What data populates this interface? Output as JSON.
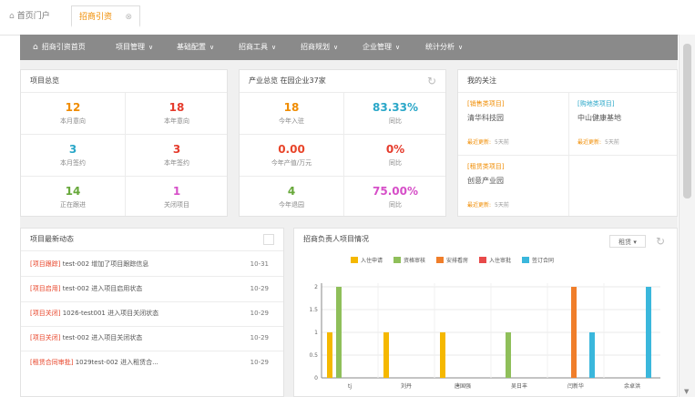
{
  "tabs": [
    {
      "label": "首页门户",
      "icon": "home-icon"
    },
    {
      "label": "招商引资",
      "icon": "close-icon"
    }
  ],
  "nav": {
    "home": "招商引资首页",
    "items": [
      "项目管理",
      "基础配置",
      "招商工具",
      "招商规划",
      "企业管理",
      "统计分析"
    ]
  },
  "project_overview": {
    "title": "项目总览",
    "stats": [
      {
        "value": "12",
        "label": "本月意向",
        "color": "#f08c00"
      },
      {
        "value": "18",
        "label": "本年意向",
        "color": "#e53b2c"
      },
      {
        "value": "3",
        "label": "本月签约",
        "color": "#2aa7c8"
      },
      {
        "value": "3",
        "label": "本年签约",
        "color": "#e53b2c"
      },
      {
        "value": "14",
        "label": "正在跟进",
        "color": "#67a83a"
      },
      {
        "value": "1",
        "label": "关闭项目",
        "color": "#d64fc8"
      }
    ]
  },
  "industry_overview": {
    "title": "产业总览 在园企业37家",
    "stats": [
      {
        "value": "18",
        "label": "今年入驻",
        "color": "#f08c00"
      },
      {
        "value": "83.33%",
        "label": "同比",
        "color": "#2aa7c8"
      },
      {
        "value": "0.00",
        "label": "今年产值/万元",
        "color": "#e8452a"
      },
      {
        "value": "0%",
        "label": "同比",
        "color": "#e53b2c"
      },
      {
        "value": "4",
        "label": "今年退园",
        "color": "#67a83a"
      },
      {
        "value": "75.00%",
        "label": "同比",
        "color": "#d64fc8"
      }
    ]
  },
  "favorites": {
    "title": "我的关注",
    "update_label": "最近更新:",
    "items": [
      {
        "category": "[销售类项目]",
        "name": "清华科技园",
        "updated": "5天前"
      },
      {
        "category": "[购地类项目]",
        "name": "中山健康基地",
        "updated": "5天前"
      },
      {
        "category": "[租赁类项目]",
        "name": "创意产业园",
        "updated": "5天前"
      }
    ]
  },
  "news": {
    "title": "项目最新动态",
    "items": [
      {
        "tag": "[项目跟踪]",
        "text": "test-002 增加了项目跟踪信息",
        "date": "10-31"
      },
      {
        "tag": "[项目启用]",
        "text": "test-002 进入项目启用状态",
        "date": "10-29"
      },
      {
        "tag": "[项目关闭]",
        "text": "1026-test001 进入项目关闭状态",
        "date": "10-29"
      },
      {
        "tag": "[项目关闭]",
        "text": "test-002 进入项目关闭状态",
        "date": "10-29"
      },
      {
        "tag": "[租赁合同审批]",
        "text": "1029test-002 进入租赁合...",
        "date": "10-29"
      }
    ]
  },
  "manager_chart": {
    "title": "招商负责人项目情况",
    "filter": "租赁"
  },
  "chart_data": {
    "type": "bar",
    "categories": [
      "tj",
      "刘丹",
      "唐国强",
      "吴日丰",
      "闫新华",
      "余卓洪"
    ],
    "series": [
      {
        "name": "入住申请",
        "color": "#f5b800",
        "values": [
          1,
          1,
          1,
          0,
          0,
          0
        ]
      },
      {
        "name": "资格审核",
        "color": "#8fbf5a",
        "values": [
          2,
          0,
          0,
          1,
          0,
          0
        ]
      },
      {
        "name": "安排看房",
        "color": "#f07e2a",
        "values": [
          0,
          0,
          0,
          0,
          2,
          0
        ]
      },
      {
        "name": "入住审批",
        "color": "#e84a4a",
        "values": [
          0,
          0,
          0,
          0,
          0,
          0
        ]
      },
      {
        "name": "签订合同",
        "color": "#3ab7dc",
        "values": [
          0,
          0,
          0,
          0,
          1,
          2
        ]
      }
    ],
    "yticks": [
      "0",
      "0.5",
      "1",
      "1.5",
      "2"
    ],
    "ylim": [
      0,
      2
    ],
    "legend": "top",
    "grid": true
  }
}
